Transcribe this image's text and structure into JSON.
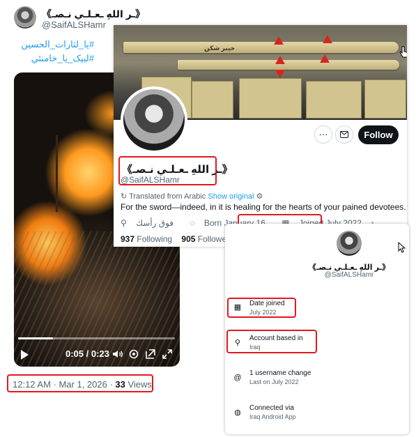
{
  "tweet": {
    "author_name": "《ـر اللهِ ـعـلـي نـصـ》",
    "author_handle": "@SaifALSHamr",
    "hashtags": [
      "#یا_لثارات_الحسین",
      "#لبیک_یا_خامنئي"
    ],
    "video": {
      "time": "0:05 / 0:23",
      "progress": 0.22
    },
    "timestamp": "12:12 AM · Mar 1, 2026 · ",
    "views_count": "33",
    "views_label": " Views"
  },
  "profile": {
    "banner_text": "خیبر شکن",
    "name": "《ـر اللهِ ـعـلـي نـصـ》",
    "handle": "@SaifALSHamr",
    "more_icon": "more-icon",
    "message_icon": "envelope-icon",
    "follow_label": "Follow",
    "translated_label": "Translated from Arabic",
    "show_original": "Show original",
    "bio": "For the sword—indeed, in it is healing for the hearts of your pained devotees.",
    "location": "فوق رأسك",
    "born": "Born January 16",
    "joined": "Joined July 2022",
    "following_count": "937",
    "following_label": " Following",
    "followers_count": "905",
    "followers_label": " Followers"
  },
  "about": {
    "name": "《ـر اللهِ ـعـلـي نـصـ》",
    "handle": "@SaifALSHamr",
    "date_joined_label": "Date joined",
    "date_joined_value": "July 2022",
    "account_based_label": "Account based in",
    "account_based_value": "Iraq",
    "username_change_label": "1 username change",
    "username_change_value": "Last on July 2022",
    "connected_label": "Connected via",
    "connected_value": "Iraq Android App"
  },
  "colors": {
    "highlight": "#e0191f",
    "link": "#1d9bf0",
    "follow_bg": "#0f1419"
  }
}
